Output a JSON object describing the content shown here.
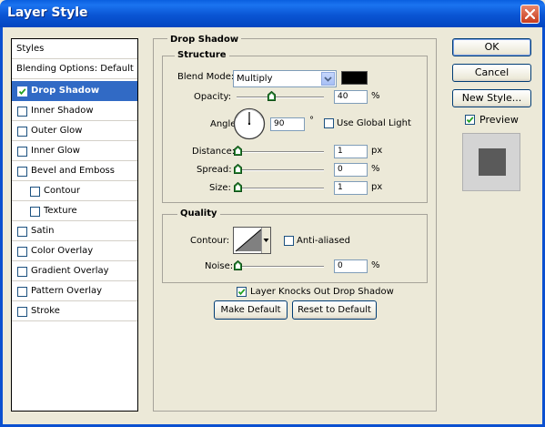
{
  "window": {
    "title": "Layer Style"
  },
  "styles_list": {
    "header": "Styles",
    "blending_options": "Blending Options: Default",
    "items": [
      {
        "label": "Drop Shadow",
        "checked": true,
        "selected": true
      },
      {
        "label": "Inner Shadow",
        "checked": false
      },
      {
        "label": "Outer Glow",
        "checked": false
      },
      {
        "label": "Inner Glow",
        "checked": false
      },
      {
        "label": "Bevel and Emboss",
        "checked": false
      },
      {
        "label": "Contour",
        "checked": false,
        "sub": true
      },
      {
        "label": "Texture",
        "checked": false,
        "sub": true
      },
      {
        "label": "Satin",
        "checked": false
      },
      {
        "label": "Color Overlay",
        "checked": false
      },
      {
        "label": "Gradient Overlay",
        "checked": false
      },
      {
        "label": "Pattern Overlay",
        "checked": false
      },
      {
        "label": "Stroke",
        "checked": false
      }
    ]
  },
  "drop_shadow": {
    "title": "Drop Shadow",
    "structure": {
      "title": "Structure",
      "blend_mode_label": "Blend Mode:",
      "blend_mode_value": "Multiply",
      "shadow_color": "#000000",
      "opacity_label": "Opacity:",
      "opacity_value": "40",
      "opacity_unit": "%",
      "angle_label": "Angle:",
      "angle_value": "90",
      "angle_unit": "°",
      "use_global_light_label": "Use Global Light",
      "use_global_light_checked": false,
      "distance_label": "Distance:",
      "distance_value": "1",
      "distance_unit": "px",
      "spread_label": "Spread:",
      "spread_value": "0",
      "spread_unit": "%",
      "size_label": "Size:",
      "size_value": "1",
      "size_unit": "px"
    },
    "quality": {
      "title": "Quality",
      "contour_label": "Contour:",
      "anti_aliased_label": "Anti-aliased",
      "anti_aliased_checked": false,
      "noise_label": "Noise:",
      "noise_value": "0",
      "noise_unit": "%"
    },
    "knockout_label": "Layer Knocks Out Drop Shadow",
    "knockout_checked": true,
    "make_default_label": "Make Default",
    "reset_default_label": "Reset to Default"
  },
  "buttons": {
    "ok": "OK",
    "cancel": "Cancel",
    "new_style": "New Style..."
  },
  "preview": {
    "label": "Preview",
    "checked": true,
    "swatch_color": "#5a5a5a"
  }
}
